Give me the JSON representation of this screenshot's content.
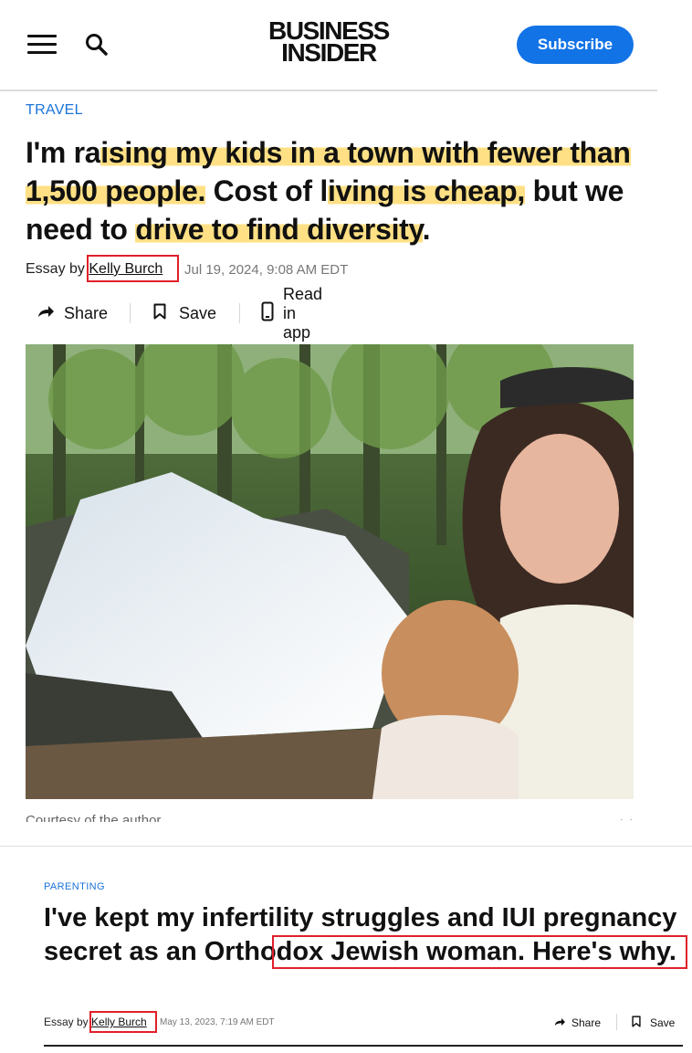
{
  "header": {
    "logo_line1": "BUSINESS",
    "logo_line2": "INSIDER",
    "subscribe_label": "Subscribe",
    "icons": {
      "menu": "hamburger-menu-icon",
      "search": "search-icon"
    }
  },
  "article1": {
    "category": "TRAVEL",
    "headline": {
      "p1": "I'm ra",
      "h1": "ising my kids in a town with fewer than 1,500 people.",
      "p2": " Cost of l",
      "h2": "iving is cheap,",
      "p3": " but we need to ",
      "h3": "drive to find diversity",
      "p4": "."
    },
    "byline_prefix": "Essay by",
    "author": "Kelly Burch",
    "date": "Jul 19, 2024, 9:08 AM EDT",
    "actions": {
      "share": "Share",
      "save": "Save",
      "read_in_app": "Read in app"
    },
    "caption": "Courtesy of the author",
    "chevron": "›"
  },
  "article2": {
    "category": "PARENTING",
    "headline_part1": "I've kept my infertility struggles and IUI pregnancy secret ",
    "headline_part2": "as an Orthodox Jewish woman.",
    "headline_part3": " Here's why.",
    "byline_prefix": "Essay by",
    "author": "Kelly Burch",
    "date": "May 13, 2023, 7:19 AM EDT",
    "actions": {
      "share": "Share",
      "save": "Save"
    }
  },
  "colors": {
    "accent": "#1273e6",
    "category": "#1a73d9",
    "highlight": "#ffe085",
    "annotation_box": "#e0202a"
  }
}
